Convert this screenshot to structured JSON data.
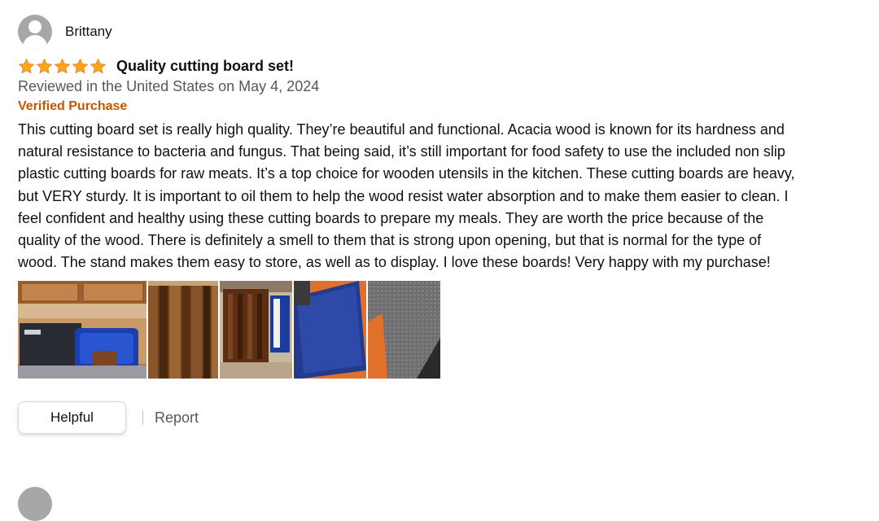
{
  "review": {
    "profile_name": "Brittany",
    "rating": 5,
    "title": "Quality cutting board set!",
    "date_text": "Reviewed in the United States on May 4, 2024",
    "verified_label": "Verified Purchase",
    "body": "This cutting board set is really high quality. They’re beautiful and functional. Acacia wood is known for its hardness and natural resistance to bacteria and fungus. That being said, it’s still important for food safety to use the included non slip plastic cutting boards for raw meats. It’s a top choice for wooden utensils in the kitchen. These cutting boards are heavy, but VERY sturdy. It is important to oil them to help the wood resist water absorption and to make them easier to clean. I feel confident and healthy using these cutting boards to prepare my meals. They are worth the price because of the quality of the wood. There is definitely a smell to them that is strong upon opening, but that is normal for the type of wood. The stand makes them easy to store, as well as to display. I love these boards! Very happy with my purchase!",
    "images": [
      {
        "name": "review-image-1"
      },
      {
        "name": "review-image-2"
      },
      {
        "name": "review-image-3"
      },
      {
        "name": "review-image-4"
      },
      {
        "name": "review-image-5"
      }
    ]
  },
  "actions": {
    "helpful_label": "Helpful",
    "report_label": "Report"
  },
  "colors": {
    "star": "#ffa41c",
    "verified": "#c45500",
    "secondary_text": "#565959"
  },
  "icons": {
    "avatar": "default-profile-avatar-icon",
    "star": "star-icon"
  }
}
